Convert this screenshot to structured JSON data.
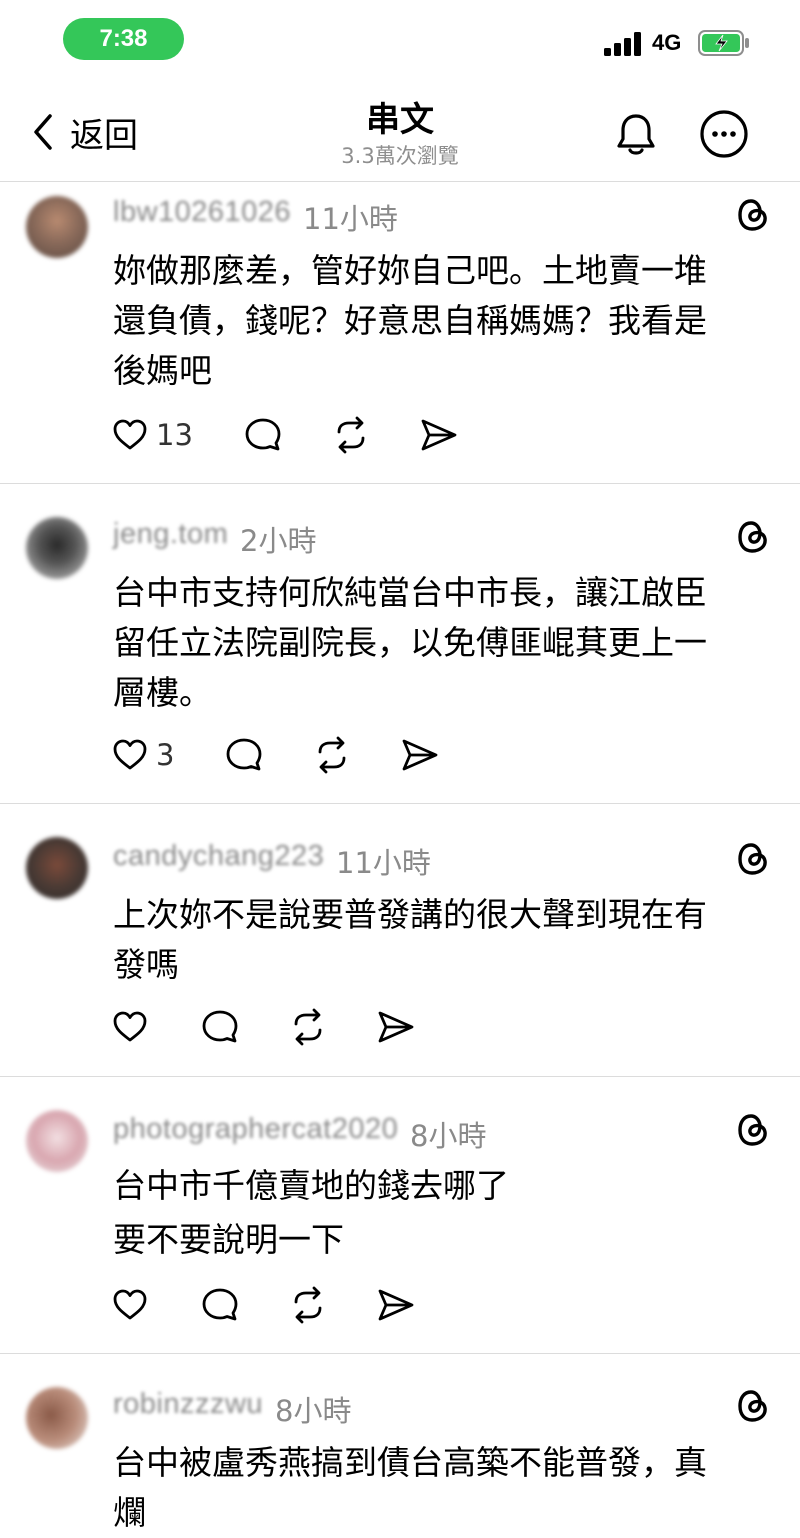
{
  "status_bar": {
    "time": "7:38",
    "network": "4G",
    "battery_color": "#34c759"
  },
  "header": {
    "back_label": "返回",
    "title": "串文",
    "views": "3.3萬次瀏覽"
  },
  "comments": [
    {
      "username": "lbw10261026",
      "time": "11小時",
      "body": [
        "妳做那麼差，管好妳自己吧。土地賣一堆",
        "還負債，錢呢？好意思自稱媽媽？我看是",
        "後媽吧"
      ],
      "likes": "13"
    },
    {
      "username": "jeng.tom",
      "time": "2小時",
      "body": [
        "台中市支持何欣純當台中市長，讓江啟臣",
        "留任立法院副院長，以免傅匪崐萁更上一",
        "層樓。"
      ],
      "likes": "3"
    },
    {
      "username": "candychang223",
      "time": "11小時",
      "body": [
        "上次妳不是說要普發講的很大聲到現在有",
        "發嗎"
      ],
      "likes": ""
    },
    {
      "username": "photographercat2020",
      "time": "8小時",
      "body": [
        "台中市千億賣地的錢去哪了",
        "要不要說明一下"
      ],
      "likes": ""
    },
    {
      "username": "robinzzzwu",
      "time": "8小時",
      "body": [
        "台中被盧秀燕搞到債台高築不能普發，真",
        "爛"
      ],
      "likes": ""
    }
  ],
  "icons": [
    "back-chevron-icon",
    "bell-icon",
    "more-icon",
    "threads-icon",
    "heart-icon",
    "comment-icon",
    "repost-icon",
    "share-icon"
  ]
}
